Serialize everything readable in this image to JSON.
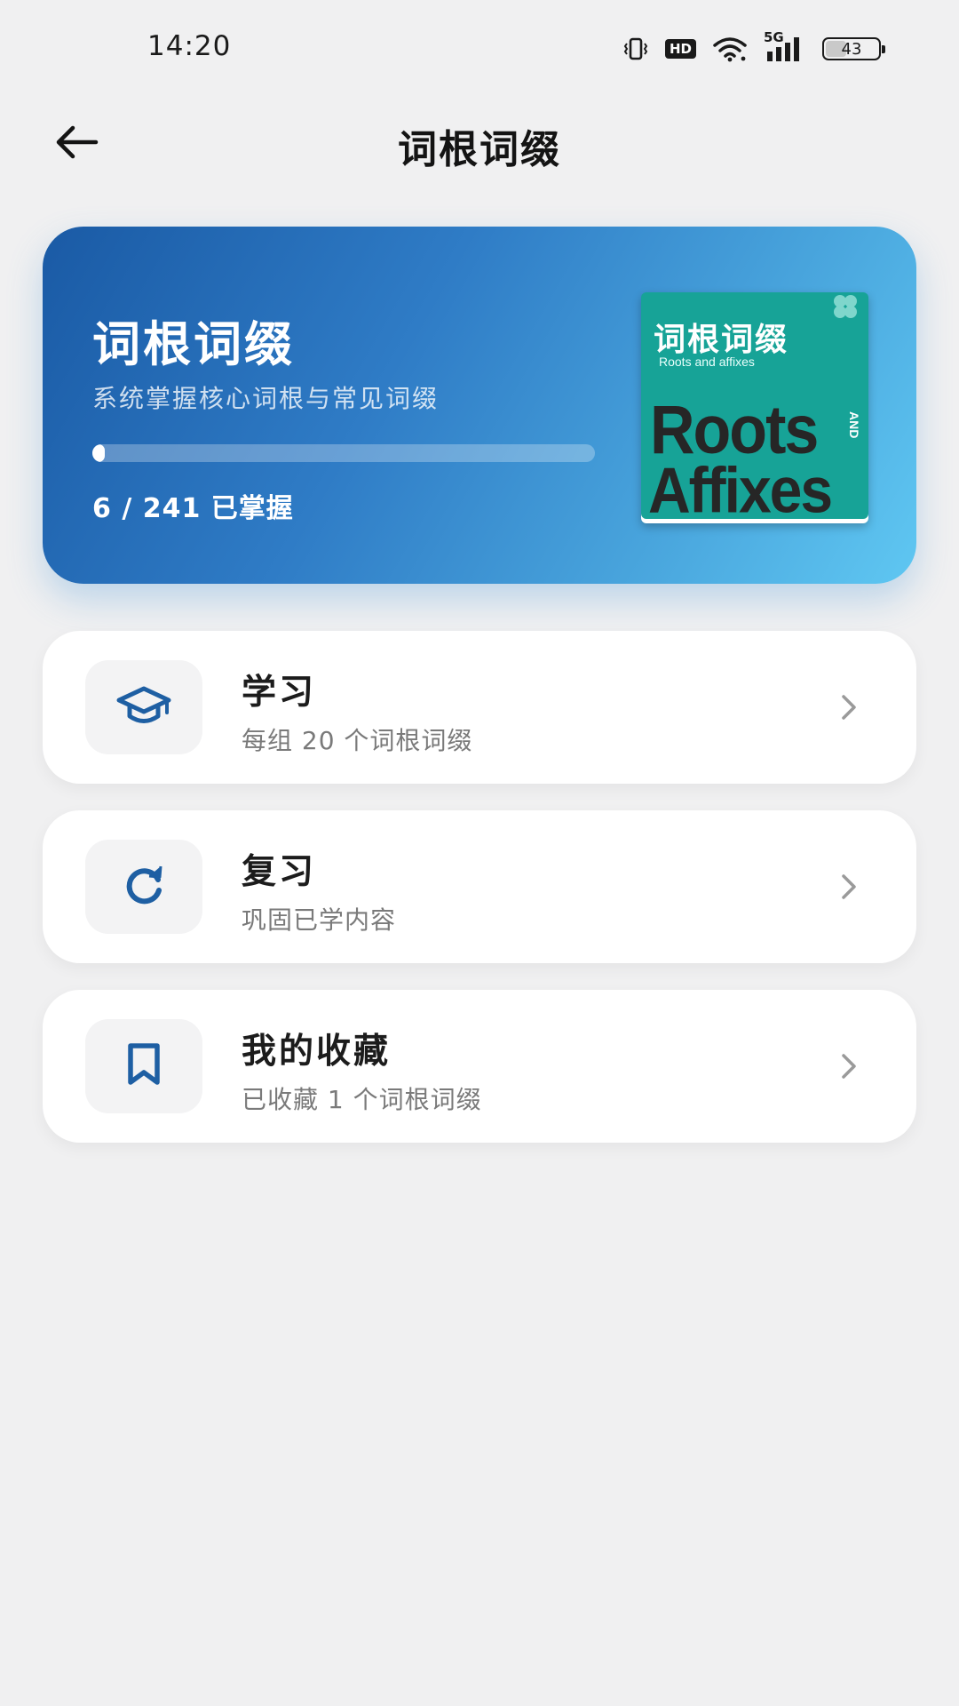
{
  "status_bar": {
    "time": "14:20",
    "hd_label": "HD",
    "network_label": "5G",
    "battery_level": "43",
    "battery_percent": 43,
    "icons": [
      "vibrate-icon",
      "hd-icon",
      "wifi-icon",
      "signal-5g-icon",
      "battery-icon"
    ]
  },
  "header": {
    "title": "词根词缀",
    "back_icon": "back-arrow-icon"
  },
  "hero": {
    "title": "词根词缀",
    "subtitle": "系统掌握核心词根与常见词缀",
    "mastered": 6,
    "total": 241,
    "progress_text": "6 / 241 已掌握",
    "cover": {
      "cn_title": "词根词缀",
      "en_subtitle": "Roots and affixes",
      "word_roots": "Roots",
      "word_and": "AND",
      "word_affixes": "Affixes"
    },
    "colors": {
      "gradient_start": "#1a5aa5",
      "gradient_end": "#5fc7f2",
      "cover": "#17a397"
    }
  },
  "menu": [
    {
      "title": "学习",
      "subtitle": "每组 20 个词根词缀",
      "icon": "graduation-cap-icon"
    },
    {
      "title": "复习",
      "subtitle": "巩固已学内容",
      "icon": "refresh-icon"
    },
    {
      "title": "我的收藏",
      "subtitle": "已收藏 1 个词根词缀",
      "icon": "bookmark-icon"
    }
  ],
  "accent_color": "#1e5fa3"
}
